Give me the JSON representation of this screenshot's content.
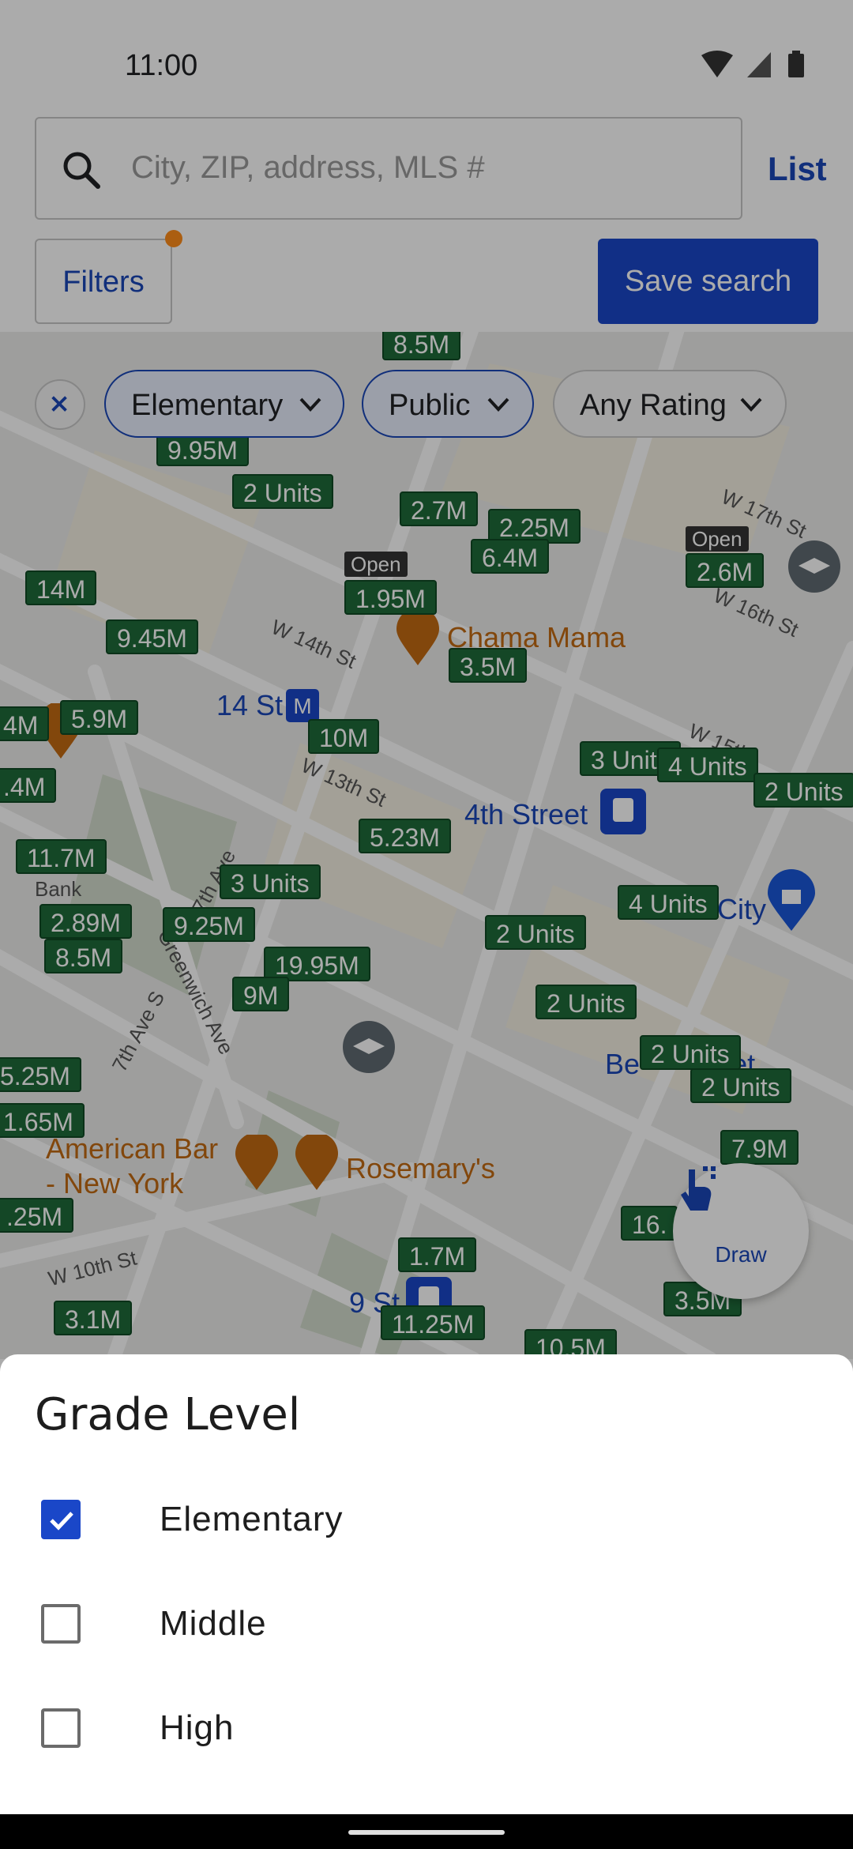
{
  "status_bar": {
    "time": "11:00"
  },
  "search": {
    "placeholder": "City, ZIP, address, MLS #",
    "list_label": "List"
  },
  "toolbar": {
    "filters_label": "Filters",
    "save_search_label": "Save search"
  },
  "filter_chips": [
    {
      "label": "Elementary"
    },
    {
      "label": "Public"
    },
    {
      "label": "Any Rating"
    }
  ],
  "map": {
    "price_tags": [
      "8.5M",
      "9.95M",
      "2 Units",
      "2.7M",
      "2.25M",
      "6.4M",
      "14M",
      "9.45M",
      "1.95M",
      "3.5M",
      "2.6M",
      "5.9M",
      "10M",
      "3 Units",
      "4 Units",
      "2 Units",
      "5.23M",
      "11.7M",
      "3 Units",
      "4 Units",
      "2.89M",
      "9.25M",
      "8.5M",
      "19.95M",
      "2 Units",
      "9M",
      "2 Units",
      "2 Units",
      "2 Units",
      "7.9M",
      "1.7M",
      "11.25M",
      "3.5M",
      "3.1M",
      "10.5M",
      "5.25M",
      "1.65M",
      ".25M",
      ".4M",
      "4M",
      "16."
    ],
    "open_labels": [
      "Open",
      "Open"
    ],
    "poi": {
      "chama": "Chama Mama",
      "station_14st": "14 St",
      "fourth_street": "4th Street",
      "city": "City",
      "american_bar": "American Bar\n- New York",
      "rosemarys": "Rosemary's",
      "bestcloset": "Be       loset",
      "nine_st": "9 St"
    },
    "streets": [
      "W 14th St",
      "W 13th St",
      "W 17th St",
      "W 16th St",
      "W 15th",
      "7th Ave",
      "Greenwich Ave",
      "7th Ave S",
      "W 10th St",
      "Bank"
    ],
    "draw_label": "Draw"
  },
  "sheet": {
    "title": "Grade Level",
    "options": [
      {
        "label": "Elementary",
        "checked": true
      },
      {
        "label": "Middle",
        "checked": false
      },
      {
        "label": "High",
        "checked": false
      }
    ]
  },
  "colors": {
    "accent": "#1a47c8",
    "price_tag": "#1e6b3a",
    "poi_orange": "#c26a12"
  }
}
